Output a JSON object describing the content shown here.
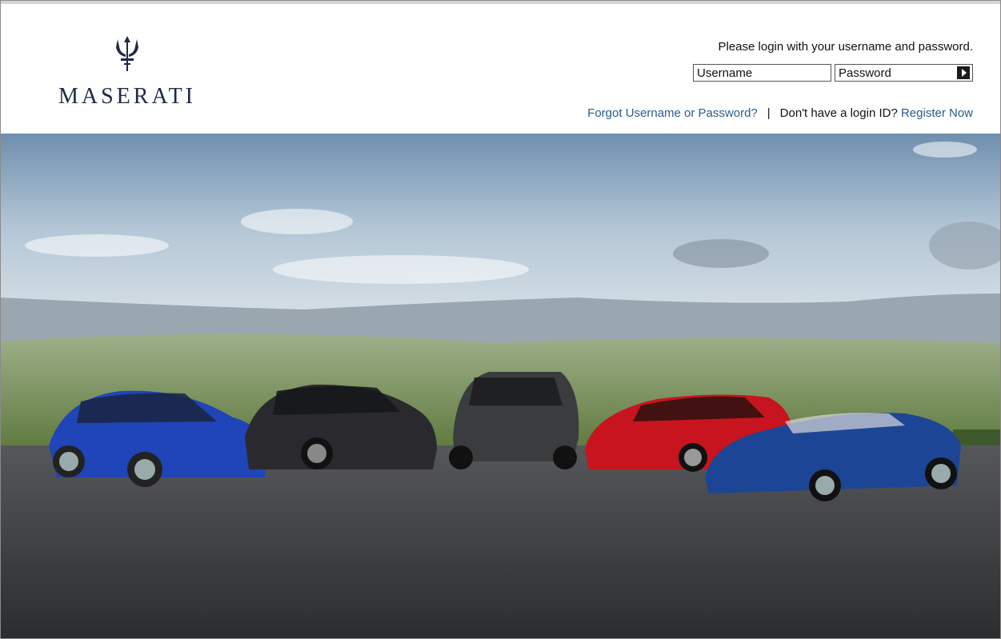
{
  "brand": {
    "name": "MASERATI",
    "logo_icon": "trident-icon",
    "color": "#1f2a44"
  },
  "login": {
    "prompt": "Please login with your username and password.",
    "username_placeholder": "Username",
    "password_placeholder": "Password",
    "submit_icon": "arrow-right-icon"
  },
  "links": {
    "forgot": "Forgot Username or Password?",
    "separator": "|",
    "no_login": "Don't have a login ID?",
    "register": "Register Now",
    "link_color": "#2b5b8a"
  },
  "hero": {
    "cars": [
      {
        "color": "#1f45b8"
      },
      {
        "color": "#2a2a2e"
      },
      {
        "color": "#3a3c3e"
      },
      {
        "color": "#c8141e"
      },
      {
        "color": "#1c4596"
      }
    ]
  }
}
